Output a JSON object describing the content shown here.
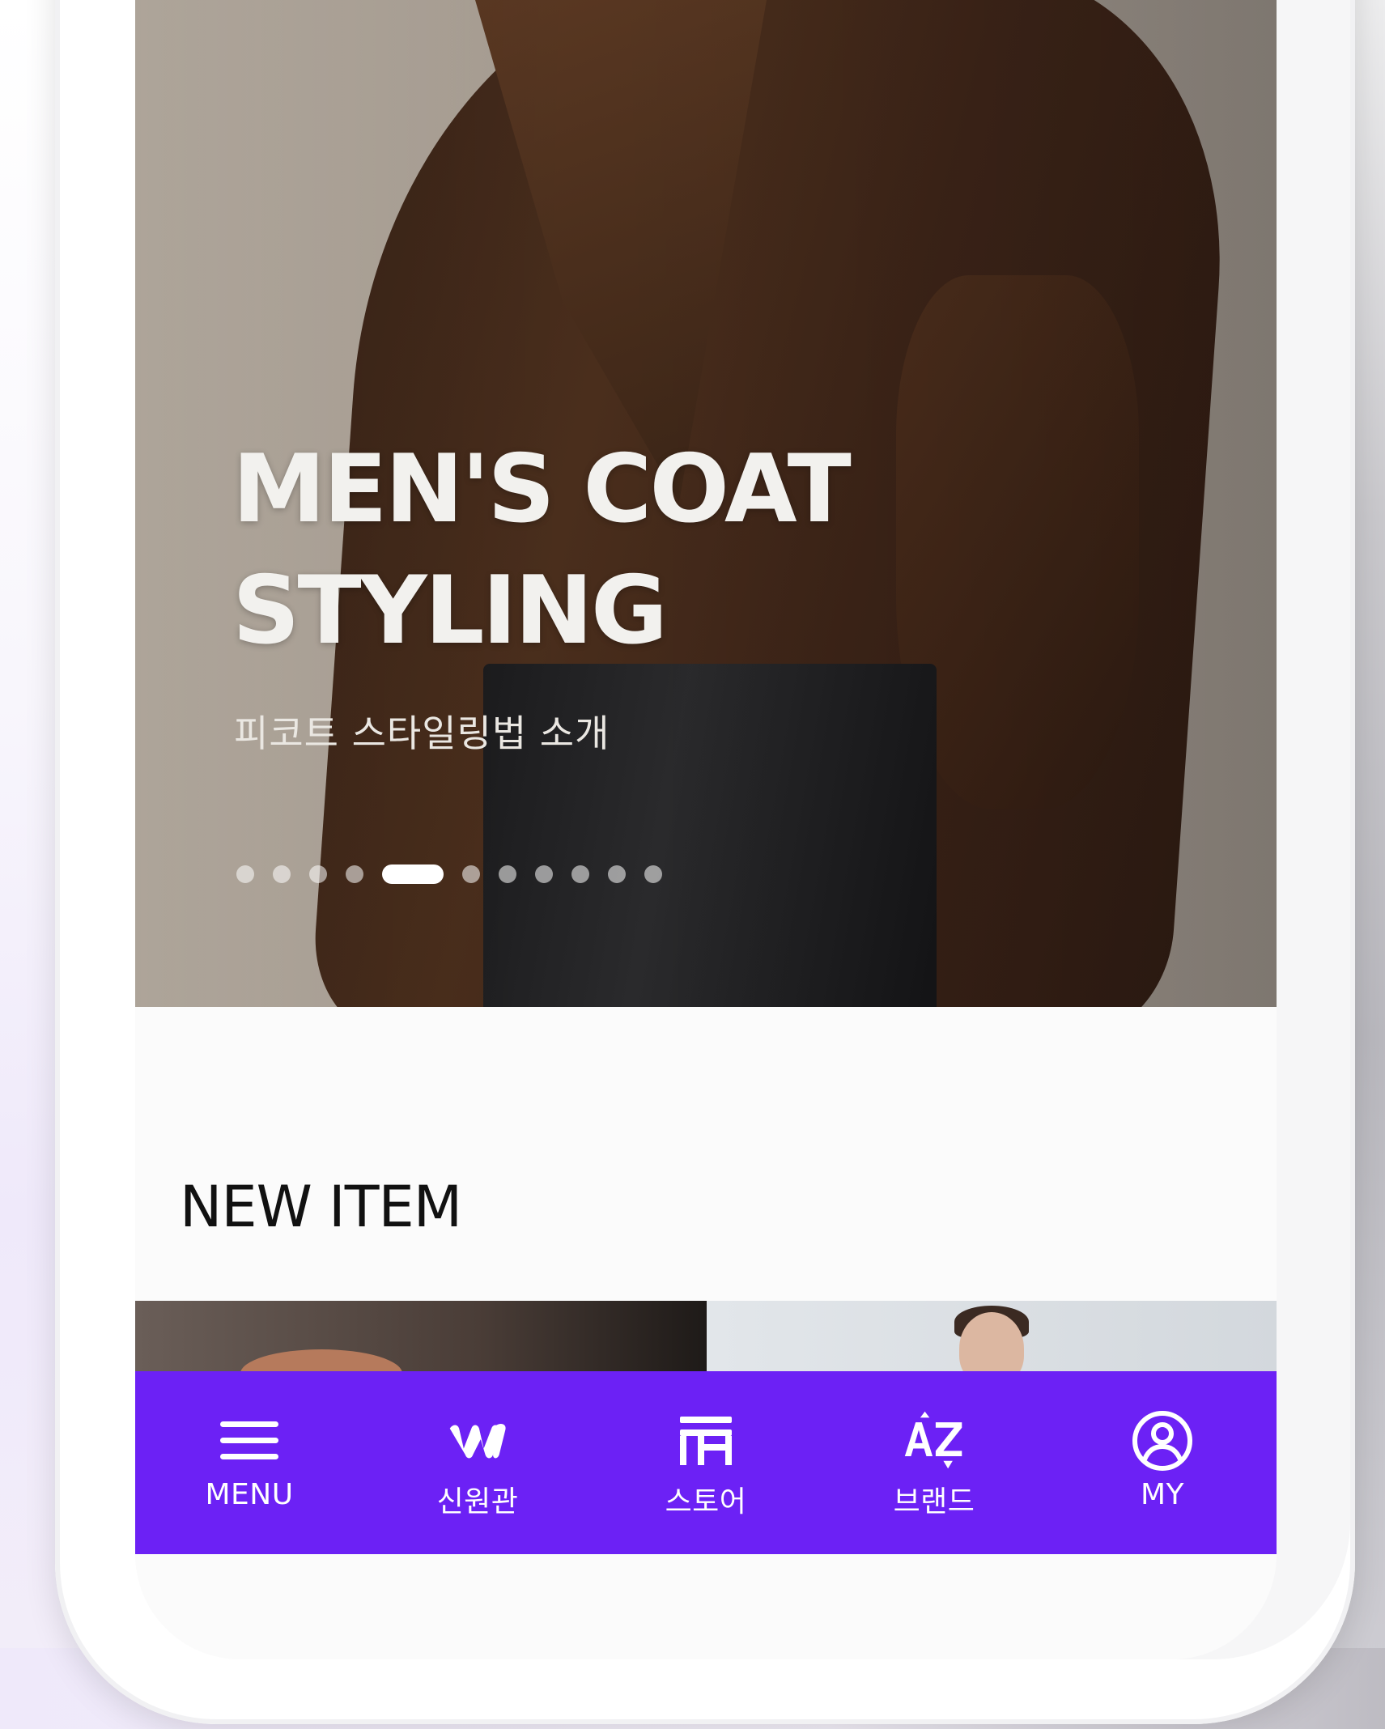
{
  "hero": {
    "title": "MEN'S COAT\nSTYLING",
    "subtitle": "피코트 스타일링법 소개",
    "carousel": {
      "total": 11,
      "active_index": 4
    }
  },
  "section": {
    "title": "NEW ITEM"
  },
  "bottom_nav": {
    "items": [
      {
        "label": "MENU",
        "icon": "hamburger-menu-icon"
      },
      {
        "label": "신원관",
        "icon": "brand-logo-icon"
      },
      {
        "label": "스토어",
        "icon": "store-icon"
      },
      {
        "label": "브랜드",
        "icon": "az-sort-icon"
      },
      {
        "label": "MY",
        "icon": "user-profile-icon"
      }
    ]
  },
  "colors": {
    "accent": "#6c21f5",
    "hero_text": "#f2f1ee",
    "section_title": "#111111"
  }
}
